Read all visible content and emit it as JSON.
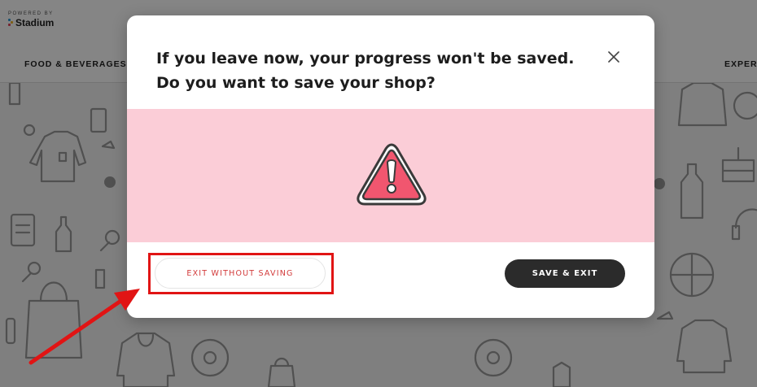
{
  "background": {
    "logo": {
      "powered_by": "POWERED BY",
      "brand": "Stadium"
    },
    "nav": {
      "left_item": "FOOD & BEVERAGES",
      "right_item": "EXPER"
    }
  },
  "modal": {
    "title_line1": "If you leave now, your progress won't be saved.",
    "title_line2": "Do you want to save your shop?",
    "close_icon": "close-icon",
    "warning_icon": "warning-triangle-icon",
    "exit_button_label": "EXIT WITHOUT SAVING",
    "save_button_label": "SAVE & EXIT"
  },
  "colors": {
    "banner": "#fbcdd7",
    "warning": "#f1566f",
    "exit_text": "#d23a3a",
    "save_button": "#2b2b2b",
    "annotation": "#e11414"
  }
}
